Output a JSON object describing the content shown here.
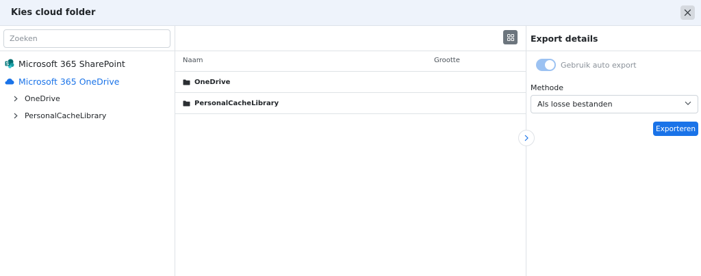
{
  "dialog": {
    "title": "Kies cloud folder"
  },
  "sidebar": {
    "search_placeholder": "Zoeken",
    "providers": [
      {
        "label": "Microsoft 365 SharePoint",
        "icon": "sharepoint-icon",
        "active": false
      },
      {
        "label": "Microsoft 365 OneDrive",
        "icon": "onedrive-cloud-icon",
        "active": true
      }
    ],
    "children": [
      {
        "label": "OneDrive",
        "icon": "chevron-right-icon"
      },
      {
        "label": "PersonalCacheLibrary",
        "icon": "chevron-right-icon"
      }
    ]
  },
  "file_list": {
    "columns": {
      "name": "Naam",
      "size": "Grootte"
    },
    "rows": [
      {
        "name": "OneDrive",
        "size": "",
        "icon": "folder-icon"
      },
      {
        "name": "PersonalCacheLibrary",
        "size": "",
        "icon": "folder-icon"
      }
    ]
  },
  "export": {
    "title": "Export details",
    "auto_export_label": "Gebruik auto export",
    "auto_export_enabled": true,
    "method_label": "Methode",
    "method_value": "Als losse bestanden",
    "export_button": "Exporteren"
  },
  "colors": {
    "accent": "#1a73e8",
    "header_bg": "#eef3fb",
    "toggle_disabled": "#9cc2f2"
  }
}
